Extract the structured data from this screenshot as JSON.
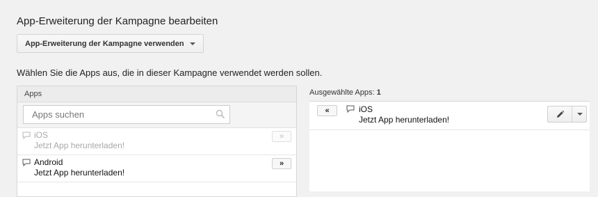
{
  "header": {
    "title": "App-Erweiterung der Kampagne bearbeiten",
    "dropdown_label": "App-Erweiterung der Kampagne verwenden"
  },
  "instruction": "Wählen Sie die Apps aus, die in dieser Kampagne verwendet werden sollen.",
  "available": {
    "header": "Apps",
    "search_placeholder": "Apps suchen",
    "items": [
      {
        "name": "iOS",
        "description": "Jetzt App herunterladen!",
        "add_label": "»",
        "state": "disabled"
      },
      {
        "name": "Android",
        "description": "Jetzt App herunterladen!",
        "add_label": "»",
        "state": "active"
      }
    ]
  },
  "selected": {
    "label": "Ausgewählte Apps:",
    "count": "1",
    "items": [
      {
        "name": "iOS",
        "description": "Jetzt App herunterladen!",
        "remove_label": "«"
      }
    ]
  },
  "icons": {
    "dropdown": "chevron-down-icon",
    "search": "search-icon",
    "item": "speech-bubble-icon",
    "edit": "pencil-icon"
  },
  "colors": {
    "background": "#f1f1f1",
    "panel": "#ffffff",
    "disabled_text": "#a8a8a8"
  }
}
